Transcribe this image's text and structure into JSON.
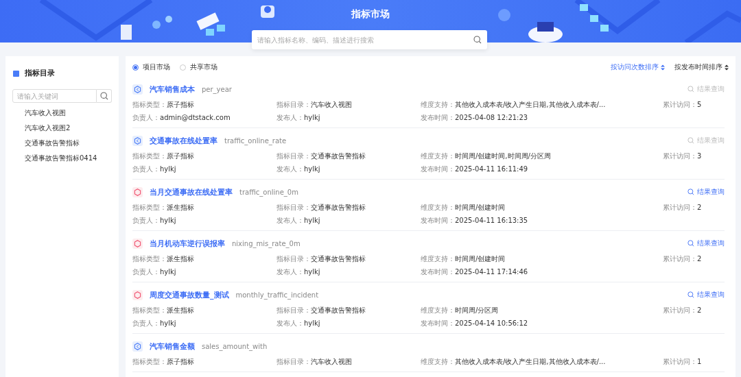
{
  "header": {
    "title": "指标市场",
    "search": {
      "placeholder": "请输入指标名称、编码、描述进行搜索"
    }
  },
  "sidebar": {
    "title": "指标目录",
    "search": {
      "placeholder": "请输入关键词"
    },
    "items": [
      {
        "label": "汽车收入视图"
      },
      {
        "label": "汽车收入视图2"
      },
      {
        "label": "交通事故告警指标"
      },
      {
        "label": "交通事故告警指标0414"
      }
    ]
  },
  "market_tabs": [
    {
      "label": "项目市场",
      "selected": true
    },
    {
      "label": "共享市场",
      "selected": false
    }
  ],
  "sort_buttons": [
    {
      "label": "按访问次数排序",
      "selected": true
    },
    {
      "label": "按发布时间排序",
      "selected": false
    }
  ],
  "metrics": [
    {
      "kind": "atomic",
      "name": "汽车销售成本",
      "code": "per_year",
      "action": {
        "label": "结果查询",
        "disabled": true
      },
      "fields": [
        {
          "label": "指标类型：",
          "value": "原子指标"
        },
        {
          "label": "指标目录：",
          "value": "汽车收入视图"
        },
        {
          "label": "维度支持：",
          "value": "其他收入成本表/收入产生日期,其他收入成本表/..."
        },
        {
          "label": "累计访问：",
          "value": "5"
        },
        {
          "label": "负责人：",
          "value": "admin@dtstack.com"
        },
        {
          "label": "发布人：",
          "value": "hylkj"
        },
        {
          "label": "发布时间：",
          "value": "2025-04-08 12:21:23"
        }
      ]
    },
    {
      "kind": "atomic",
      "name": "交通事故在线处置率",
      "code": "traffic_online_rate",
      "action": {
        "label": "结果查询",
        "disabled": true
      },
      "fields": [
        {
          "label": "指标类型：",
          "value": "原子指标"
        },
        {
          "label": "指标目录：",
          "value": "交通事故告警指标"
        },
        {
          "label": "维度支持：",
          "value": "时间周/创建时间,时间周/分区周"
        },
        {
          "label": "累计访问：",
          "value": "3"
        },
        {
          "label": "负责人：",
          "value": "hylkj"
        },
        {
          "label": "发布人：",
          "value": "hylkj"
        },
        {
          "label": "发布时间：",
          "value": "2025-04-11 16:11:49"
        }
      ]
    },
    {
      "kind": "derived",
      "name": "当月交通事故在线处置率",
      "code": "traffic_online_0m",
      "action": {
        "label": "结果查询",
        "disabled": false
      },
      "fields": [
        {
          "label": "指标类型：",
          "value": "派生指标"
        },
        {
          "label": "指标目录：",
          "value": "交通事故告警指标"
        },
        {
          "label": "维度支持：",
          "value": "时间周/创建时间"
        },
        {
          "label": "累计访问：",
          "value": "2"
        },
        {
          "label": "负责人：",
          "value": "hylkj"
        },
        {
          "label": "发布人：",
          "value": "hylkj"
        },
        {
          "label": "发布时间：",
          "value": "2025-04-11 16:13:35"
        }
      ]
    },
    {
      "kind": "derived",
      "name": "当月机动车逆行误报率",
      "code": "nixing_mis_rate_0m",
      "action": {
        "label": "结果查询",
        "disabled": false
      },
      "fields": [
        {
          "label": "指标类型：",
          "value": "派生指标"
        },
        {
          "label": "指标目录：",
          "value": "交通事故告警指标"
        },
        {
          "label": "维度支持：",
          "value": "时间周/创建时间"
        },
        {
          "label": "累计访问：",
          "value": "2"
        },
        {
          "label": "负责人：",
          "value": "hylkj"
        },
        {
          "label": "发布人：",
          "value": "hylkj"
        },
        {
          "label": "发布时间：",
          "value": "2025-04-11 17:14:46"
        }
      ]
    },
    {
      "kind": "derived",
      "name": "周度交通事故数量_测试",
      "code": "monthly_traffic_incident",
      "action": {
        "label": "结果查询",
        "disabled": false
      },
      "fields": [
        {
          "label": "指标类型：",
          "value": "派生指标"
        },
        {
          "label": "指标目录：",
          "value": "交通事故告警指标"
        },
        {
          "label": "维度支持：",
          "value": "时间周/分区周"
        },
        {
          "label": "累计访问：",
          "value": "2"
        },
        {
          "label": "负责人：",
          "value": "hylkj"
        },
        {
          "label": "发布人：",
          "value": "hylkj"
        },
        {
          "label": "发布时间：",
          "value": "2025-04-14 10:56:12"
        }
      ]
    },
    {
      "kind": "atomic",
      "name": "汽车销售金额",
      "code": "sales_amount_with",
      "fields": [
        {
          "label": "指标类型：",
          "value": "原子指标"
        },
        {
          "label": "指标目录：",
          "value": "汽车收入视图"
        },
        {
          "label": "维度支持：",
          "value": "其他收入成本表/收入产生日期,其他收入成本表/..."
        },
        {
          "label": "累计访问：",
          "value": "1"
        }
      ]
    }
  ]
}
